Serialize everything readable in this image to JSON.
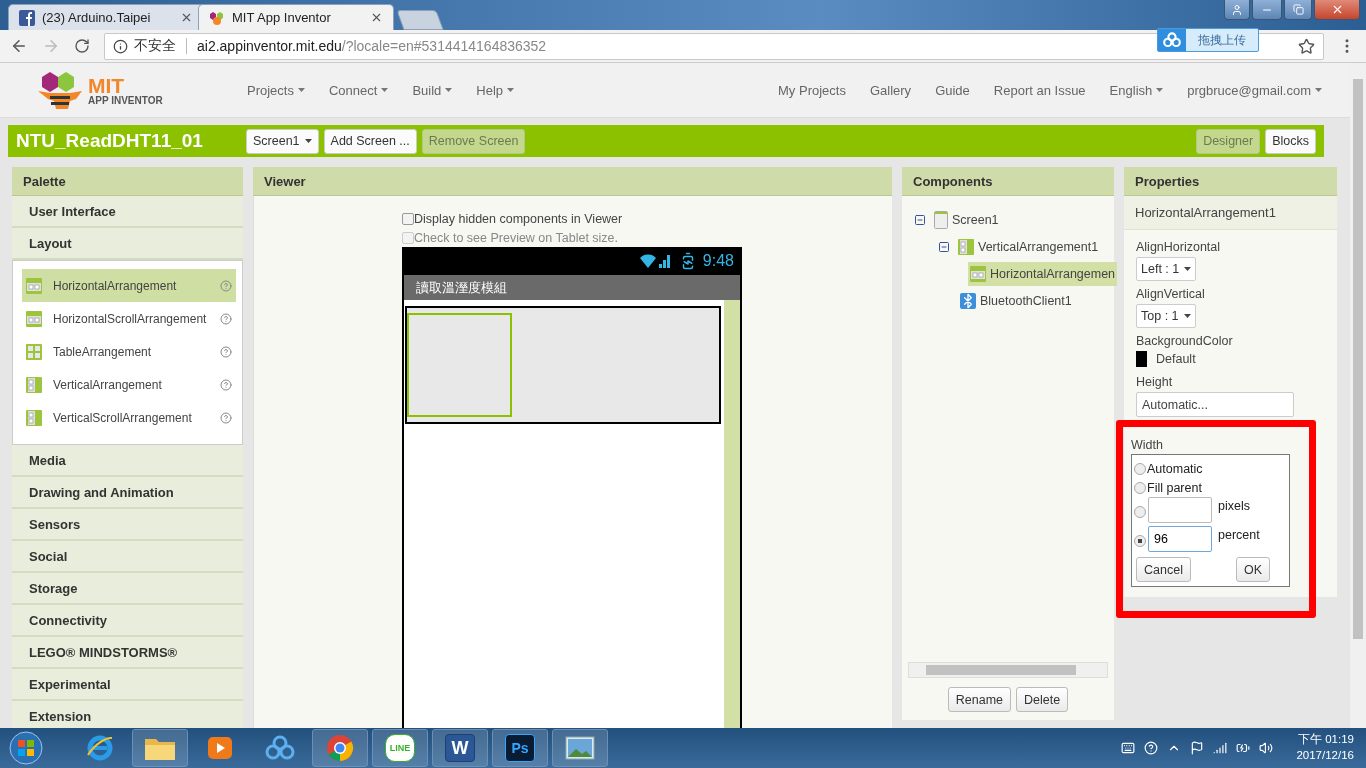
{
  "browser": {
    "tabs": [
      {
        "kind": "facebook",
        "title": "(23) Arduino.Taipei",
        "selected": false
      },
      {
        "kind": "appinventor",
        "title": "MIT App Inventor",
        "selected": true
      }
    ],
    "url": {
      "security": "不安全",
      "host": "ai2.appinventor.mit.edu",
      "path": "/?locale=en#5314414164836352"
    },
    "upload_button": "拖拽上传"
  },
  "header": {
    "logo": {
      "line1": "MIT",
      "line2": "APP INVENTOR"
    },
    "menus": [
      {
        "label": "Projects",
        "dropdown": true
      },
      {
        "label": "Connect",
        "dropdown": true
      },
      {
        "label": "Build",
        "dropdown": true
      },
      {
        "label": "Help",
        "dropdown": true
      }
    ],
    "links": [
      {
        "label": "My Projects",
        "dropdown": false
      },
      {
        "label": "Gallery",
        "dropdown": false
      },
      {
        "label": "Guide",
        "dropdown": false
      },
      {
        "label": "Report an Issue",
        "dropdown": false
      },
      {
        "label": "English",
        "dropdown": true
      },
      {
        "label": "prgbruce@gmail.com",
        "dropdown": true
      }
    ]
  },
  "toolbar": {
    "project_name": "NTU_ReadDHT11_01",
    "buttons": [
      {
        "label": "Screen1",
        "dropdown": true,
        "disabled": false
      },
      {
        "label": "Add Screen ...",
        "dropdown": false,
        "disabled": false
      },
      {
        "label": "Remove Screen",
        "dropdown": false,
        "disabled": true
      }
    ],
    "modes": [
      {
        "label": "Designer",
        "selected": true
      },
      {
        "label": "Blocks",
        "selected": false
      }
    ]
  },
  "palette": {
    "title": "Palette",
    "categories": [
      {
        "label": "User Interface"
      },
      {
        "label": "Layout",
        "items": [
          {
            "label": "HorizontalArrangement",
            "kind": "horizontal",
            "selected": true
          },
          {
            "label": "HorizontalScrollArrangement",
            "kind": "horizontal",
            "selected": false
          },
          {
            "label": "TableArrangement",
            "kind": "table",
            "selected": false
          },
          {
            "label": "VerticalArrangement",
            "kind": "vertical",
            "selected": false
          },
          {
            "label": "VerticalScrollArrangement",
            "kind": "vertical",
            "selected": false
          }
        ]
      },
      {
        "label": "Media"
      },
      {
        "label": "Drawing and Animation"
      },
      {
        "label": "Sensors"
      },
      {
        "label": "Social"
      },
      {
        "label": "Storage"
      },
      {
        "label": "Connectivity"
      },
      {
        "label": "LEGO® MINDSTORMS®"
      },
      {
        "label": "Experimental"
      },
      {
        "label": "Extension"
      }
    ]
  },
  "viewer": {
    "title": "Viewer",
    "options": [
      {
        "label": "Display hidden components in Viewer",
        "checked": false,
        "disabled": false
      },
      {
        "label": "Check to see Preview on Tablet size.",
        "checked": false,
        "disabled": true
      }
    ],
    "phone": {
      "time": "9:48",
      "title": "讀取溫溼度模組"
    }
  },
  "components": {
    "title": "Components",
    "tree": [
      {
        "label": "Screen1",
        "kind": "screen",
        "selected": false,
        "expanded": true,
        "children": [
          {
            "label": "VerticalArrangement1",
            "kind": "vertical",
            "selected": false,
            "expanded": true,
            "children": [
              {
                "label": "HorizontalArrangemen",
                "kind": "horizontal",
                "selected": true,
                "expanded": false
              }
            ]
          },
          {
            "label": "BluetoothClient1",
            "kind": "bluetooth",
            "selected": false,
            "expanded": false
          }
        ]
      }
    ],
    "buttons": [
      "Rename",
      "Delete"
    ]
  },
  "properties": {
    "title": "Properties",
    "component": "HorizontalArrangement1",
    "fields": [
      {
        "kind": "dropdown",
        "label": "AlignHorizontal",
        "value": "Left : 1"
      },
      {
        "kind": "dropdown",
        "label": "AlignVertical",
        "value": "Top : 1"
      },
      {
        "kind": "color",
        "label": "BackgroundColor",
        "value": "Default",
        "color": "#000000"
      },
      {
        "kind": "text",
        "label": "Height",
        "value": "Automatic..."
      }
    ],
    "width_popup": {
      "label": "Width",
      "options": [
        {
          "kind": "radio",
          "label": "Automatic",
          "selected": false
        },
        {
          "kind": "radio",
          "label": "Fill parent",
          "selected": false
        },
        {
          "kind": "input",
          "unit": "pixels",
          "selected": false
        },
        {
          "kind": "input",
          "unit": "percent",
          "value": "96",
          "selected": true
        }
      ],
      "buttons": [
        "Cancel",
        "OK"
      ]
    }
  },
  "taskbar": {
    "apps": [
      {
        "kind": "ie"
      },
      {
        "kind": "folder"
      },
      {
        "kind": "media"
      },
      {
        "kind": "cloud"
      },
      {
        "kind": "chrome"
      },
      {
        "kind": "line",
        "label": "LINE"
      },
      {
        "kind": "word",
        "label": "W"
      },
      {
        "kind": "photoshop",
        "label": "Ps"
      },
      {
        "kind": "photos"
      }
    ],
    "clock": {
      "time": "下午 01:19",
      "date": "2017/12/16"
    }
  }
}
